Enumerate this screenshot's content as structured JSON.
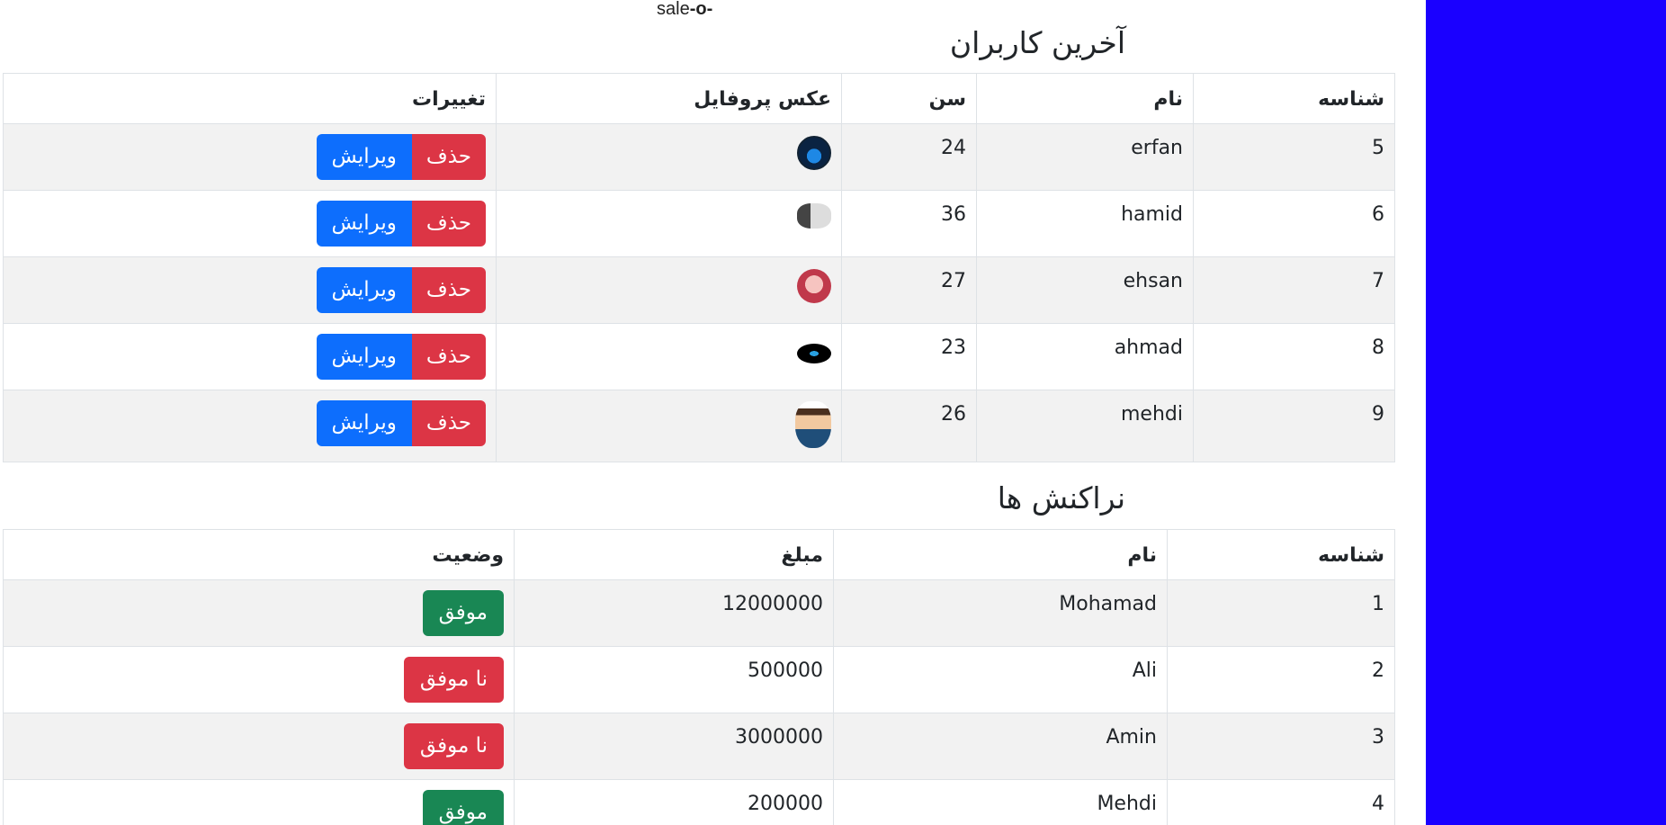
{
  "logo": {
    "text": "sale",
    "mark": "-o-"
  },
  "users_section": {
    "title": "آخرین کاربران",
    "headers": [
      "شناسه",
      "نام",
      "سن",
      "عکس پروفایل",
      "تغییرات"
    ],
    "delete_label": "حذف",
    "edit_label": "ویرایش",
    "rows": [
      {
        "id": "5",
        "name": "erfan",
        "age": "24"
      },
      {
        "id": "6",
        "name": "hamid",
        "age": "36"
      },
      {
        "id": "7",
        "name": "ehsan",
        "age": "27"
      },
      {
        "id": "8",
        "name": "ahmad",
        "age": "23"
      },
      {
        "id": "9",
        "name": "mehdi",
        "age": "26"
      }
    ]
  },
  "transactions_section": {
    "title": "نراکنش ها",
    "headers": [
      "شناسه",
      "نام",
      "مبلغ",
      "وضعیت"
    ],
    "rows": [
      {
        "id": "1",
        "name": "Mohamad",
        "amount": "12000000",
        "status": "موفق",
        "status_type": "success"
      },
      {
        "id": "2",
        "name": "Ali",
        "amount": "500000",
        "status": "نا موفق",
        "status_type": "fail"
      },
      {
        "id": "3",
        "name": "Amin",
        "amount": "3000000",
        "status": "نا موفق",
        "status_type": "fail"
      },
      {
        "id": "4",
        "name": "Mehdi",
        "amount": "200000",
        "status": "موفق",
        "status_type": "success"
      }
    ]
  },
  "colors": {
    "sidebar": "#1a00ff",
    "success": "#198754",
    "danger": "#dc3545",
    "primary": "#0d6efd",
    "stripe": "#f2f2f2"
  }
}
